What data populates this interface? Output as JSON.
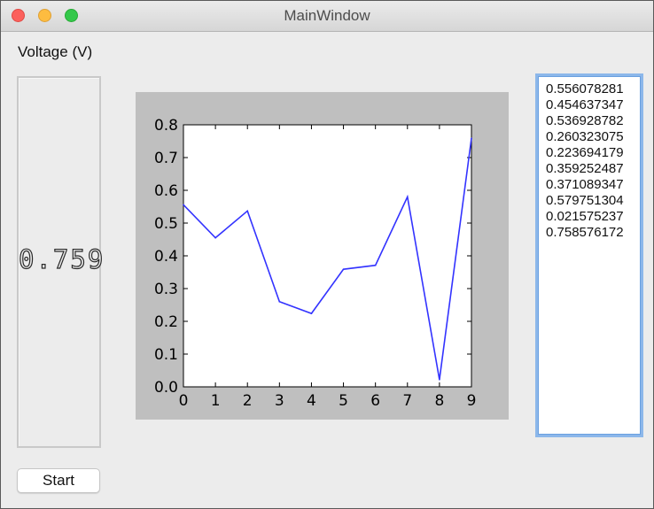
{
  "window": {
    "title": "MainWindow"
  },
  "voltage": {
    "label": "Voltage (V)",
    "display": "0.759"
  },
  "start_button": {
    "label": "Start"
  },
  "list": {
    "items": [
      "0.556078281",
      "0.454637347",
      "0.536928782",
      "0.260323075",
      "0.223694179",
      "0.359252487",
      "0.371089347",
      "0.579751304",
      "0.021575237",
      "0.758576172"
    ]
  },
  "colors": {
    "line": "#3333ff",
    "plot_background": "#bfbfbf",
    "list_focus": "#8cb7ea"
  },
  "chart_data": {
    "type": "line",
    "x": [
      0,
      1,
      2,
      3,
      4,
      5,
      6,
      7,
      8,
      9
    ],
    "series": [
      {
        "values": [
          0.556,
          0.455,
          0.537,
          0.26,
          0.224,
          0.359,
          0.371,
          0.58,
          0.022,
          0.759
        ]
      }
    ],
    "xlim": [
      0,
      9
    ],
    "ylim": [
      0.0,
      0.8
    ],
    "xticks": [
      "0",
      "1",
      "2",
      "3",
      "4",
      "5",
      "6",
      "7",
      "8",
      "9"
    ],
    "yticks": [
      "0.0",
      "0.1",
      "0.2",
      "0.3",
      "0.4",
      "0.5",
      "0.6",
      "0.7",
      "0.8"
    ],
    "title": "",
    "xlabel": "",
    "ylabel": "",
    "grid": false
  }
}
